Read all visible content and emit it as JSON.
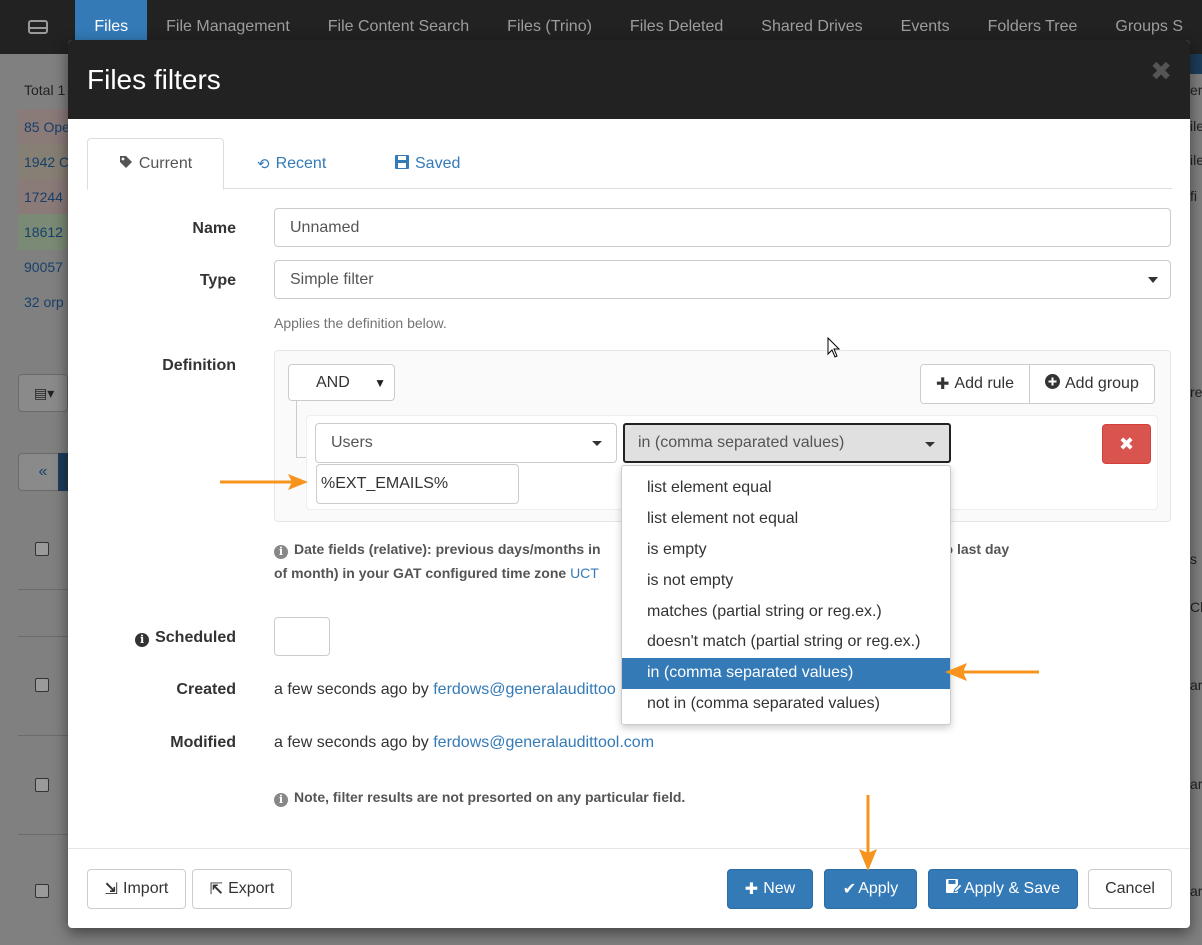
{
  "app": {
    "nav_tabs": [
      "Files",
      "File Management",
      "File Content Search",
      "Files (Trino)",
      "Files Deleted",
      "Shared Drives",
      "Events",
      "Folders Tree",
      "Groups S"
    ],
    "total_label": "Total 1",
    "rows": [
      "85 Ope",
      "1942 C",
      "17244",
      "18612",
      "90057",
      "32 orp"
    ],
    "pager_prev": "«",
    "right_edge": [
      "ers",
      "ile",
      "ile",
      "fi",
      "re",
      "s",
      "Cl",
      "ar",
      "ar",
      "ar"
    ]
  },
  "modal": {
    "title": "Files filters",
    "close": "✖",
    "tabs": [
      {
        "label": "Current",
        "icon": "tag-icon"
      },
      {
        "label": "Recent",
        "icon": "history-icon"
      },
      {
        "label": "Saved",
        "icon": "floppy-icon"
      }
    ],
    "name_label": "Name",
    "name_value": "Unnamed",
    "type_label": "Type",
    "type_value": "Simple filter",
    "type_help": "Applies the definition below.",
    "definition_label": "Definition",
    "combinator": "AND",
    "add_rule": "Add rule",
    "add_group": "Add group",
    "rule_field": "Users",
    "rule_operator": "in (comma separated values)",
    "rule_value": "%EXT_EMAILS%",
    "date_note_1": "Date fields (relative): previous days/months in",
    "date_note_1b": "o last day",
    "date_note_2": "of month) in your GAT configured time zone",
    "date_note_tz": "UCT",
    "scheduled_label": "Scheduled",
    "created_label": "Created",
    "created_text": "a few seconds ago by",
    "created_user": "ferdows@generalaudittoo",
    "modified_label": "Modified",
    "modified_text": "a few seconds ago by",
    "modified_user": "ferdows@generalaudittool.com",
    "sort_note": "Note, filter results are not presorted on any particular field.",
    "footer": {
      "import": "Import",
      "export": "Export",
      "new": "New",
      "apply": "Apply",
      "apply_save": "Apply & Save",
      "cancel": "Cancel"
    }
  },
  "dropdown": {
    "options": [
      "list element equal",
      "list element not equal",
      "is empty",
      "is not empty",
      "matches (partial string or reg.ex.)",
      "doesn't match (partial string or reg.ex.)",
      "in (comma separated values)",
      "not in (comma separated values)"
    ],
    "selected_index": 6
  },
  "colors": {
    "primary": "#337ab7",
    "danger": "#d9534f",
    "annotation_arrow": "#f7941d",
    "header": "#222222"
  }
}
